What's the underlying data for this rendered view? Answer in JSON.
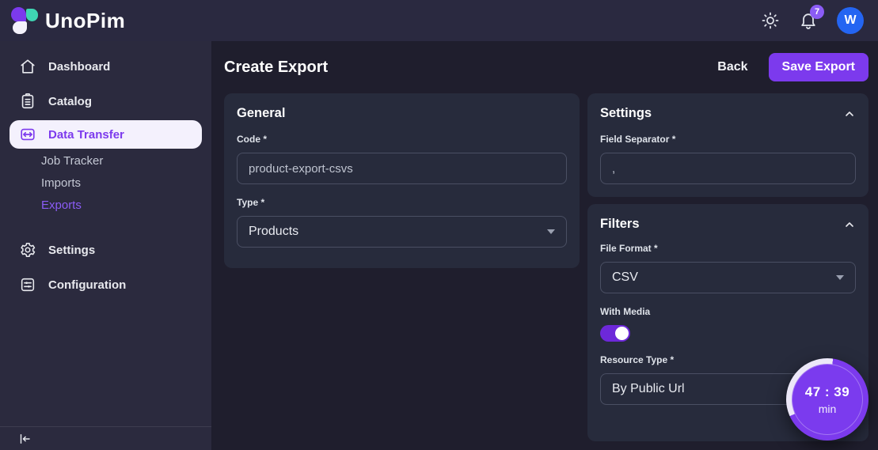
{
  "app": {
    "name": "UnoPim"
  },
  "topbar": {
    "notification_count": "7",
    "avatar_initial": "W"
  },
  "sidebar": {
    "items": [
      {
        "label": "Dashboard"
      },
      {
        "label": "Catalog"
      },
      {
        "label": "Data Transfer",
        "active": true
      },
      {
        "label": "Job Tracker"
      },
      {
        "label": "Imports"
      },
      {
        "label": "Exports",
        "active": true
      },
      {
        "label": "Settings"
      },
      {
        "label": "Configuration"
      }
    ]
  },
  "header": {
    "title": "Create Export",
    "back_label": "Back",
    "save_label": "Save Export"
  },
  "general": {
    "title": "General",
    "code_label": "Code *",
    "code_value": "product-export-csvs",
    "type_label": "Type *",
    "type_value": "Products"
  },
  "settings_panel": {
    "title": "Settings",
    "field_separator_label": "Field Separator *",
    "field_separator_value": ","
  },
  "filters_panel": {
    "title": "Filters",
    "file_format_label": "File Format *",
    "file_format_value": "CSV",
    "with_media_label": "With Media",
    "with_media_on": true,
    "resource_type_label": "Resource Type *",
    "resource_type_value": "By Public Url"
  },
  "timer": {
    "time": "47 : 39",
    "unit": "min"
  },
  "colors": {
    "accent": "#7c3aed",
    "logo_teal": "#3fd6b3",
    "avatar_blue": "#2465f2",
    "badge_purple": "#8b5cf6",
    "topbar_bg": "#2a2940",
    "sidebar_bg": "#2b2a3e",
    "main_bg": "#1f1e2d",
    "card_bg": "#272b3c"
  }
}
